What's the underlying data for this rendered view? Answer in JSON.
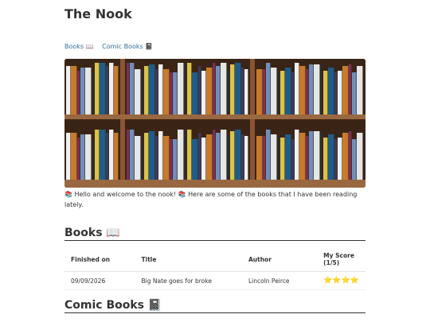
{
  "site": {
    "title": "The Nook"
  },
  "nav": [
    {
      "label": "Books 📖"
    },
    {
      "label": "Comic Books 📓"
    }
  ],
  "hero": {
    "icon": "bookshelf-photo"
  },
  "intro": {
    "text": "📚 Hello and welcome to the nook! 📚 Here are some of the books that I have been reading lately."
  },
  "books_section": {
    "heading": "Books 📖",
    "columns": [
      "Finished on",
      "Title",
      "Author",
      "My Score (1/5)"
    ],
    "rows": [
      {
        "finished": "09/09/2026",
        "title": "Big Nate goes for broke",
        "author": "Lincoln Peirce",
        "score": "⭐⭐⭐⭐"
      }
    ]
  },
  "comics_section": {
    "heading": "Comic Books 📓"
  }
}
